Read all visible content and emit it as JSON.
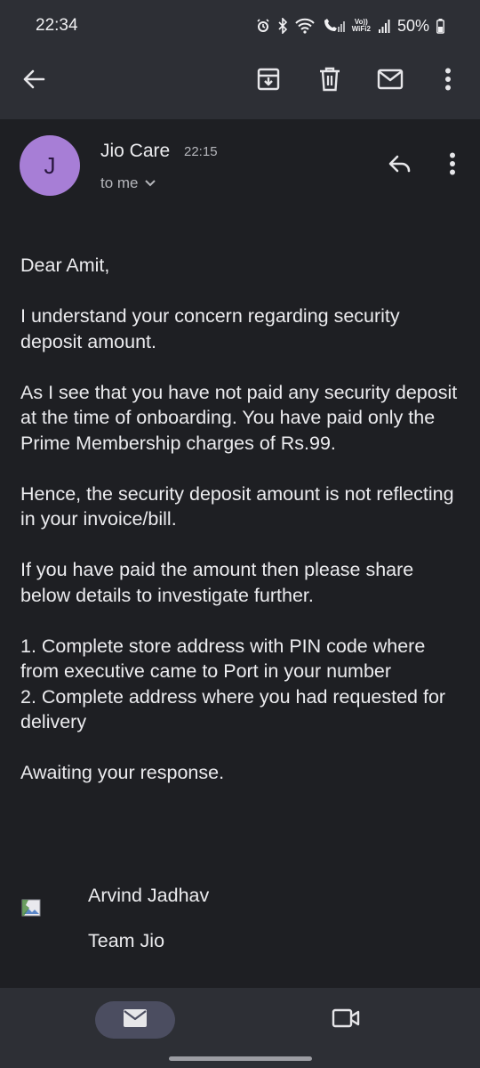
{
  "status_bar": {
    "time": "22:34",
    "battery": "50%",
    "volte_top": "Vo))",
    "volte_bottom": "WiFi2"
  },
  "app_bar": {
    "icons": [
      "back-arrow-icon",
      "archive-icon",
      "delete-icon",
      "mark-unread-icon",
      "more-vert-icon"
    ]
  },
  "message": {
    "avatar_letter": "J",
    "sender": "Jio Care",
    "time": "22:15",
    "recipient": "to me",
    "body": [
      "Dear Amit,",
      "I understand your concern regarding security deposit amount.",
      "As I see that you have not paid any security deposit at the time of onboarding. You have paid only the Prime Membership charges of Rs.99.",
      "Hence, the security deposit amount is not reflecting in your invoice/bill.",
      "If you have paid the amount then please share below details to investigate further.",
      "1. Complete store address with PIN code where from executive came to Port in your number",
      "2. Complete address where you had requested for delivery",
      "Awaiting your response."
    ],
    "signature_name": "Arvind Jadhav",
    "signature_team": "Team Jio"
  },
  "bottom_nav": {
    "items": [
      "mail-icon",
      "video-icon"
    ],
    "active": "mail-icon"
  },
  "colors": {
    "background": "#1e1f23",
    "bar": "#2d2f35",
    "avatar": "#a77ed6",
    "active_pill": "#4b4d60"
  }
}
